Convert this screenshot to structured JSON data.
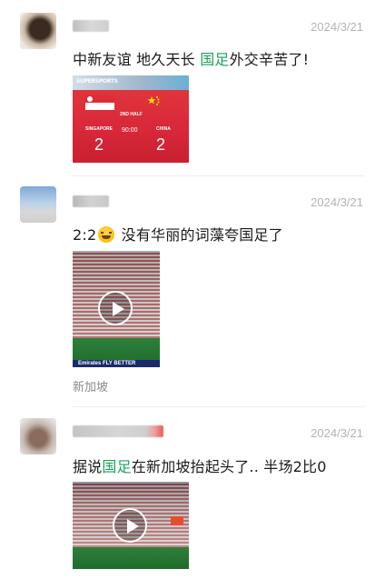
{
  "posts": [
    {
      "date": "2024/3/21",
      "text_before": "中新友谊 地久天长 ",
      "text_highlight": "国足",
      "text_after": "外交辛苦了!",
      "scoreboard": {
        "logo": "SUPERSPORTS",
        "half": "2ND HALF",
        "time": "90:00",
        "home": "SINGAPORE",
        "away": "CHINA",
        "home_score": "2",
        "away_score": "2"
      }
    },
    {
      "date": "2024/3/21",
      "text_before": "2:2",
      "emoji": "laughing-face",
      "text_after": " 没有华丽的词藻夸国足了",
      "video_banner": "Emirates  FLY BETTER",
      "location": "新加坡"
    },
    {
      "date": "2024/3/21",
      "text_before": "据说",
      "text_highlight": "国足",
      "text_after": "在新加坡抬起头了.. 半场2比0"
    }
  ],
  "colors": {
    "highlight": "#1aa35a",
    "date": "#b3b3b3",
    "location": "#8a8a8a"
  }
}
